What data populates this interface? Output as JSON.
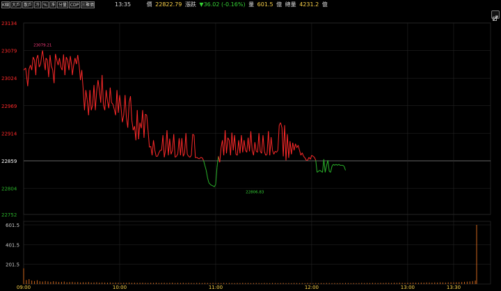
{
  "toolbar": {
    "buttons": [
      "K線",
      "大戶",
      "散戶",
      "冷",
      "%",
      "淨",
      "分量",
      "CDP",
      "三聚價"
    ]
  },
  "info": {
    "time": "13:35",
    "price_label": "價",
    "price": "22822.79",
    "change_label": "漲跌",
    "change": "▼36.02 (-0.16%)",
    "volume_label": "量",
    "volume": "601.5",
    "volume_unit": "億",
    "total_label": "總量",
    "total": "4231.2",
    "total_unit": "億"
  },
  "icons": {
    "link": "link-icon"
  },
  "colors": {
    "up": "#ff2a2a",
    "down": "#2bb52b",
    "ref": "#ffffff",
    "volume": "#d2691e",
    "high_label": "#ff3d7f",
    "low_label": "#35d435"
  },
  "chart_data": [
    {
      "type": "line",
      "title": "",
      "reference": 22859,
      "ylim": [
        22752,
        23134
      ],
      "y_ticks": [
        "23134",
        "23079",
        "23024",
        "22969",
        "22914",
        "22859",
        "22804",
        "22752"
      ],
      "x_ticks": [
        "09:00",
        "10:00",
        "11:00",
        "12:00",
        "13:00",
        "13:30"
      ],
      "high_label": "23079.21",
      "low_label": "22806.83",
      "series": [
        {
          "t": [
            0,
            3,
            6,
            8,
            10,
            12,
            14,
            16,
            18,
            19,
            21,
            23,
            25,
            27,
            28,
            30,
            32,
            33,
            35,
            37,
            39,
            41,
            43,
            45,
            47,
            49,
            51,
            53,
            55,
            57,
            59,
            61,
            63,
            65,
            67,
            69,
            71,
            72,
            74,
            76,
            78,
            80,
            82,
            84,
            86,
            88,
            90,
            92,
            94,
            96,
            98,
            100,
            102,
            104,
            106,
            108,
            110,
            112,
            114,
            116,
            118,
            120,
            122,
            124,
            126,
            128,
            130,
            132,
            134,
            136,
            138,
            140,
            142,
            144,
            146,
            148,
            150,
            152,
            154,
            156,
            158,
            160,
            162,
            164,
            166,
            168,
            170,
            172,
            174,
            176,
            178,
            180,
            182,
            184,
            186,
            188,
            190,
            192,
            194,
            196,
            198,
            200,
            202,
            204,
            206,
            208,
            210,
            212,
            214,
            216,
            218,
            220,
            222,
            224,
            226,
            228,
            230,
            232,
            234,
            236,
            238,
            240,
            242,
            244,
            246,
            248,
            250,
            252,
            254,
            256,
            258,
            260,
            262,
            264,
            266,
            268,
            270,
            272,
            274,
            276,
            278,
            280,
            282,
            284,
            286,
            288,
            290,
            292,
            294,
            296,
            298,
            300,
            302,
            304,
            306,
            308,
            310,
            312,
            314,
            316,
            318,
            320,
            322,
            324,
            326,
            328,
            330,
            332,
            334,
            336,
            338,
            340,
            342,
            344,
            346,
            348,
            350,
            352,
            354,
            356,
            358,
            360,
            362,
            364,
            366,
            368,
            370,
            372,
            374,
            376,
            378,
            380,
            382,
            384,
            386,
            388,
            390,
            392,
            394,
            396,
            398,
            400,
            402,
            404,
            406,
            408,
            410,
            412,
            414,
            416,
            418,
            420,
            422,
            424,
            426,
            428,
            430,
            432,
            434,
            436,
            438,
            440,
            442,
            444,
            446,
            448,
            450,
            452,
            454,
            456,
            458,
            460,
            462,
            464,
            466,
            468,
            470,
            472,
            474,
            476,
            478,
            480,
            482,
            484,
            486,
            488,
            490,
            492,
            494,
            496,
            498,
            500,
            502,
            504,
            506,
            508,
            510,
            512,
            514,
            516,
            518,
            520,
            522,
            524,
            526,
            528,
            530,
            532,
            534,
            536,
            538,
            540,
            542,
            544,
            546,
            548,
            550,
            552,
            554,
            556,
            558,
            560,
            562,
            564,
            566,
            568,
            570,
            572,
            574,
            576,
            578,
            580,
            582,
            584,
            586,
            588,
            590,
            592,
            594,
            596,
            598,
            600,
            602,
            604,
            606,
            608,
            610,
            612,
            614,
            616,
            618,
            620,
            622,
            624,
            626,
            628,
            630,
            632,
            634,
            636,
            638,
            640,
            642,
            644,
            646,
            648,
            650,
            652,
            654,
            656,
            658,
            660,
            662,
            664,
            666,
            668,
            670
          ],
          "values": [
            23040,
            23044,
            23008,
            23042,
            23050,
            23040,
            23066,
            23060,
            23030,
            23062,
            23070,
            23046,
            23052,
            23072,
            23079,
            23056,
            23040,
            23064,
            23060,
            23026,
            23070,
            23048,
            23040,
            23014,
            23072,
            23060,
            23050,
            23064,
            23046,
            23040,
            23071,
            23030,
            23066,
            23060,
            23040,
            23068,
            23050,
            23030,
            23050,
            23064,
            23052,
            23070,
            23050,
            23020,
            23040,
            23002,
            22960,
            23000,
            22980,
            22950,
            23000,
            22960,
            22970,
            23010,
            22960,
            22998,
            23020,
            23000,
            22975,
            23030,
            22970,
            22960,
            23000,
            22978,
            22964,
            23005,
            22975,
            22972,
            22962,
            22950,
            23000,
            22955,
            22990,
            22966,
            22936,
            22950,
            22990,
            22945,
            22925,
            22975,
            22988,
            22940,
            22920,
            22928,
            22900,
            22960,
            22902,
            22935,
            22924,
            22960,
            22905,
            22952,
            22950,
            22920,
            22886,
            22888,
            22870,
            22900,
            22880,
            22868,
            22868,
            22875,
            22880,
            22880,
            22910,
            22866,
            22882,
            22920,
            22870,
            22903,
            22872,
            22880,
            22912,
            22866,
            22868,
            22873,
            22904,
            22870,
            22904,
            22868,
            22874,
            22914,
            22872,
            22868,
            22866,
            22870,
            22912,
            22910,
            22865,
            22866,
            22864,
            22863,
            22866,
            22865,
            22860,
            22850,
            22840,
            22825,
            22815,
            22812,
            22810,
            22809,
            22807,
            22812,
            22846,
            22868,
            22856,
            22885,
            22900,
            22870,
            22920,
            22874,
            22905,
            22900,
            22870,
            22915,
            22880,
            22910,
            22872,
            22870,
            22900,
            22874,
            22910,
            22876,
            22900,
            22880,
            22876,
            22905,
            22878,
            22918,
            22880,
            22870,
            22896,
            22878,
            22876,
            22914,
            22878,
            22874,
            22910,
            22878,
            22870,
            22872,
            22918,
            22870,
            22906,
            22880,
            22872,
            22878,
            22876,
            22880,
            22930,
            22935,
            22925,
            22868,
            22930,
            22860,
            22912,
            22865,
            22898,
            22872,
            22895,
            22880,
            22893,
            22885,
            22890,
            22880,
            22870,
            22875,
            22868,
            22865,
            22860,
            22860,
            22866,
            22862,
            22870,
            22868,
            22866,
            22860,
            22836,
            22838,
            22840,
            22838,
            22836,
            22862,
            22836,
            22850,
            22860,
            22838,
            22836,
            22848,
            22852,
            22850,
            22852,
            22850,
            22852,
            22850,
            22850,
            22850,
            22848,
            22840
          ],
          "line_color_by_reference": true
        },
        {
          "name": "",
          "type": "bar",
          "ylim": [
            0,
            601.5
          ],
          "y_ticks": [
            "601.5",
            "401.5",
            "201.5"
          ],
          "t": [
            0,
            4,
            8,
            12,
            16,
            20,
            24,
            28,
            32,
            36,
            40,
            44,
            48,
            52,
            56,
            60,
            64,
            68,
            72,
            76,
            80,
            84,
            88,
            92,
            96,
            100,
            104,
            108,
            112,
            116,
            120,
            124,
            128,
            132,
            136,
            140,
            144,
            148,
            152,
            156,
            160,
            164,
            168,
            172,
            176,
            180,
            184,
            188,
            192,
            196,
            200,
            204,
            208,
            212,
            216,
            220,
            224,
            228,
            232,
            236,
            240,
            244,
            248,
            252,
            256,
            260,
            264,
            268,
            272,
            276,
            280,
            284,
            288,
            292,
            296,
            300,
            304,
            308,
            312,
            316,
            320,
            324,
            328,
            332,
            336,
            340,
            344,
            348,
            352,
            356,
            360,
            364,
            368,
            372,
            376,
            380,
            384,
            388,
            392,
            396,
            400,
            404,
            408,
            412,
            416,
            420,
            424,
            428,
            432,
            436,
            440,
            444,
            448,
            452,
            456,
            460,
            464,
            468,
            472,
            476,
            480,
            484,
            488,
            492,
            496,
            500,
            504,
            508,
            512,
            516,
            520,
            524,
            528,
            532,
            536,
            540,
            544,
            548,
            552,
            556,
            560,
            564,
            568,
            572,
            576,
            580,
            584,
            588,
            592,
            596,
            600,
            604,
            608,
            612,
            616,
            620,
            624,
            628,
            632,
            636,
            640,
            644,
            648,
            652,
            656,
            660,
            664,
            668,
            670
          ],
          "values": [
            160,
            40,
            50,
            35,
            30,
            38,
            28,
            25,
            30,
            26,
            22,
            28,
            24,
            20,
            22,
            25,
            18,
            20,
            22,
            18,
            20,
            16,
            18,
            17,
            20,
            15,
            16,
            18,
            14,
            16,
            15,
            14,
            16,
            13,
            15,
            14,
            12,
            14,
            13,
            15,
            12,
            14,
            12,
            13,
            14,
            12,
            11,
            13,
            12,
            14,
            11,
            12,
            13,
            11,
            12,
            14,
            10,
            12,
            11,
            13,
            10,
            12,
            11,
            10,
            12,
            11,
            10,
            12,
            11,
            10,
            12,
            10,
            11,
            10,
            12,
            10,
            11,
            10,
            9,
            11,
            10,
            12,
            10,
            11,
            9,
            10,
            11,
            10,
            9,
            11,
            10,
            9,
            11,
            10,
            9,
            10,
            11,
            9,
            10,
            9,
            11,
            10,
            9,
            10,
            9,
            11,
            10,
            9,
            10,
            9,
            10,
            9,
            11,
            10,
            9,
            10,
            9,
            10,
            9,
            11,
            10,
            9,
            10,
            9,
            10,
            12,
            10,
            11,
            10,
            12,
            11,
            10,
            12,
            11,
            13,
            12,
            11,
            13,
            12,
            14,
            13,
            12,
            14,
            13,
            15,
            14,
            13,
            15,
            14,
            16,
            15,
            14,
            16,
            15,
            17,
            16,
            15,
            17,
            18,
            17,
            18,
            19,
            20,
            22,
            24,
            26,
            30,
            35,
            601.5
          ]
        }
      ]
    }
  ]
}
